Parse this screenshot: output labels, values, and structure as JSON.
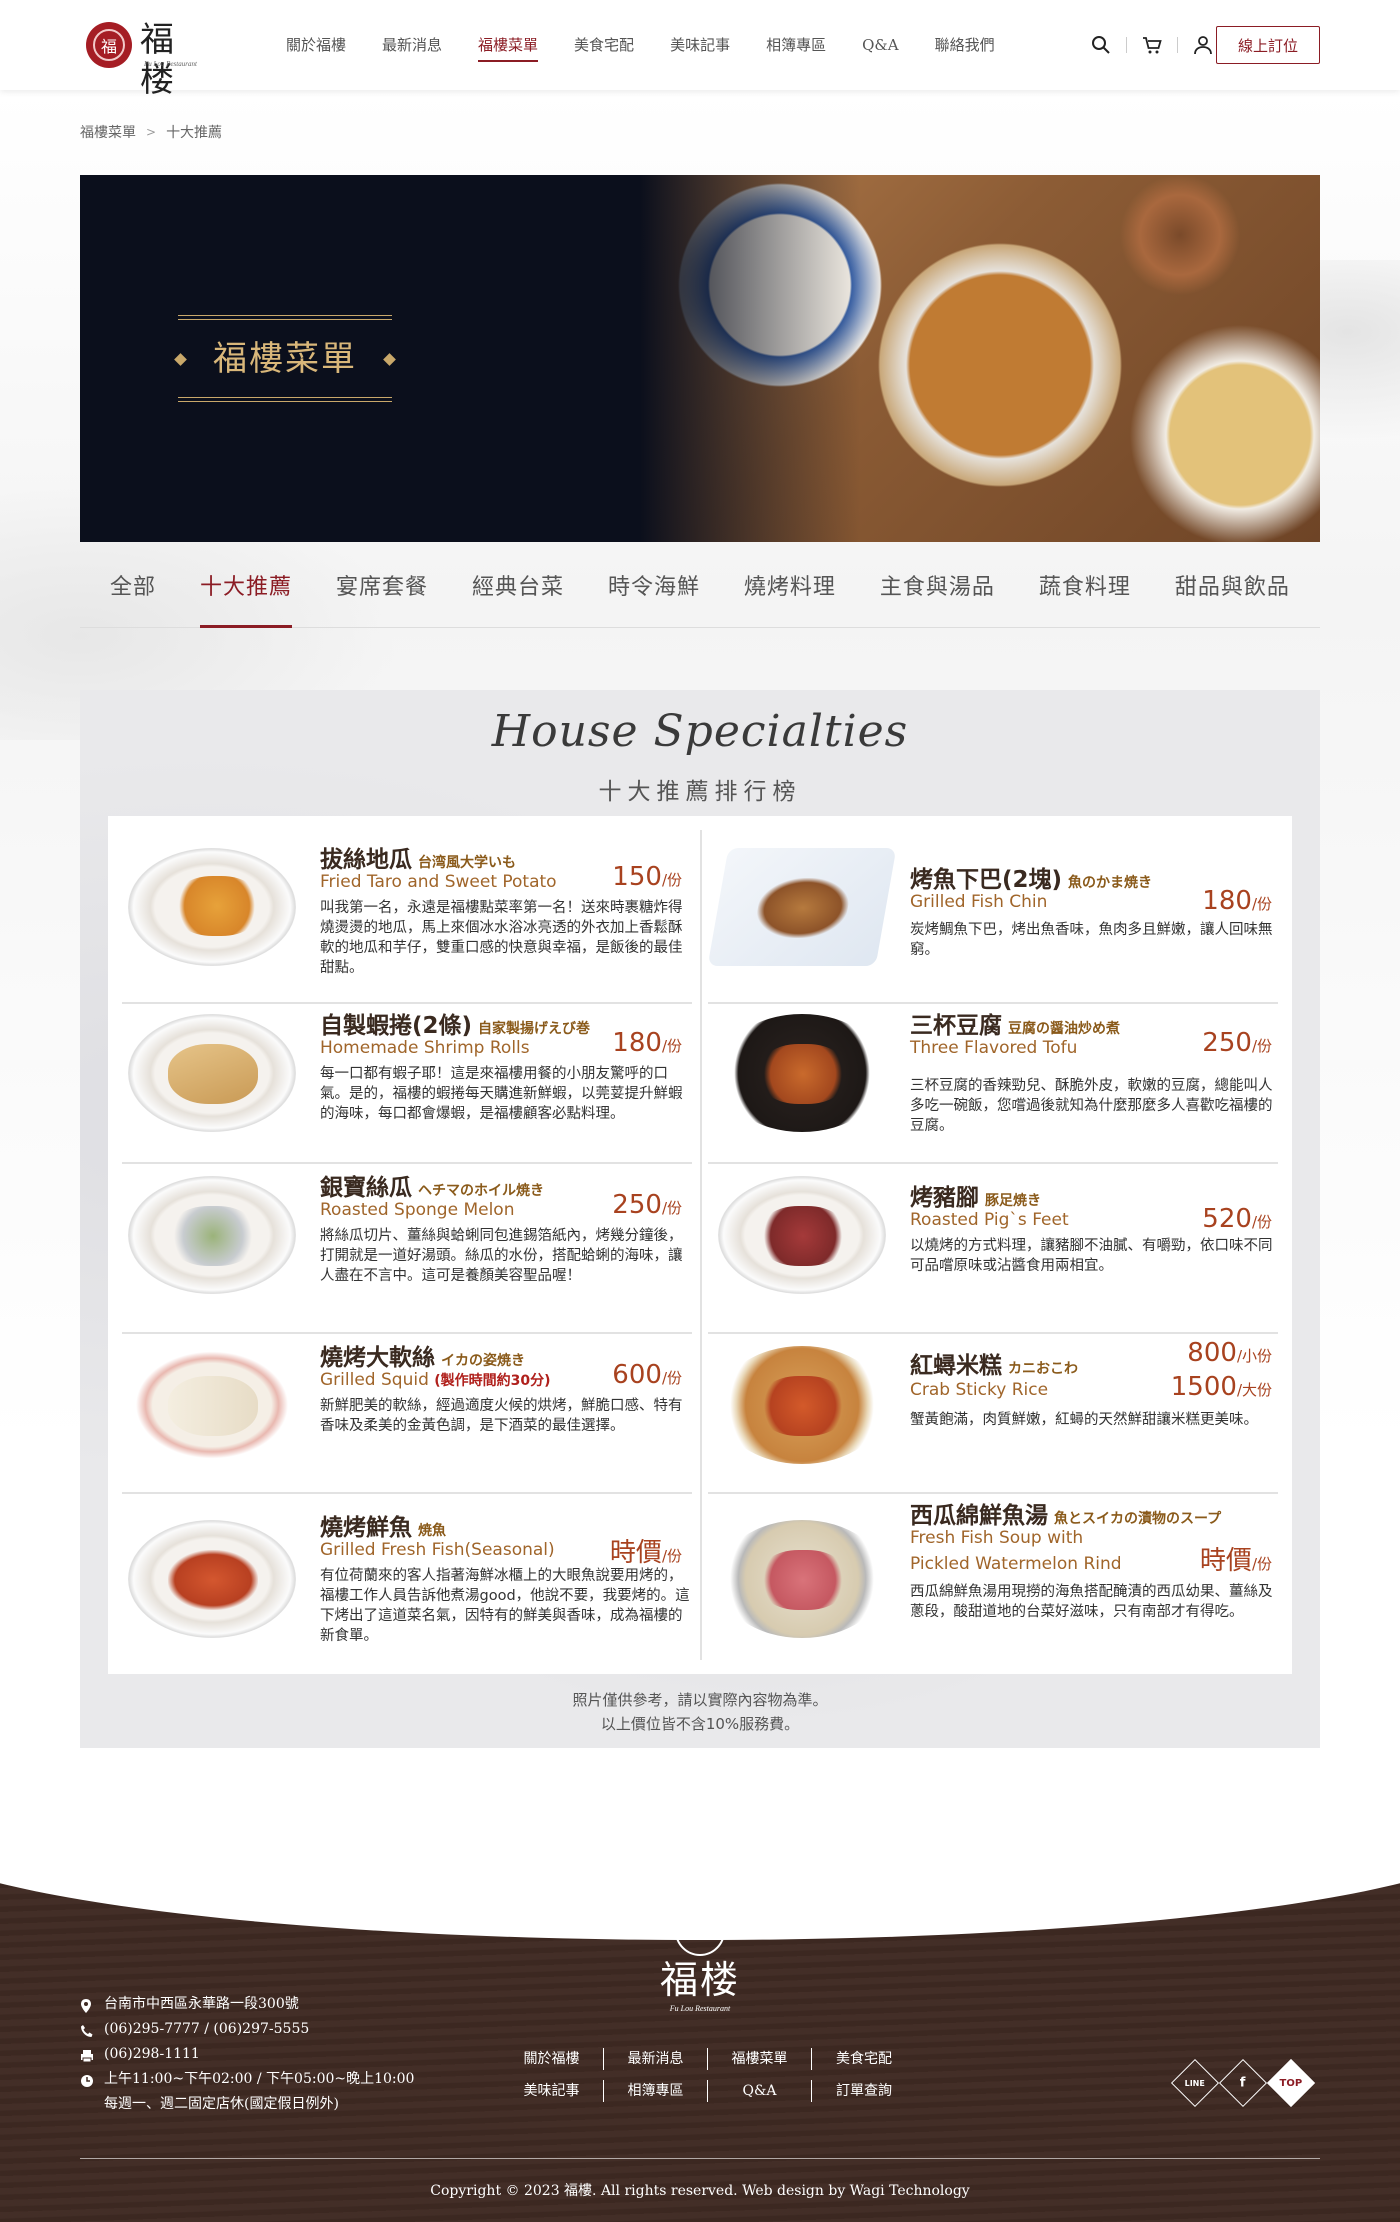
{
  "header": {
    "logo_text": "福楼",
    "logo_sub": "Fu Lou Restaurant",
    "nav": [
      "關於福樓",
      "最新消息",
      "福樓菜單",
      "美食宅配",
      "美味記事",
      "相簿專區",
      "Q&A",
      "聯絡我們"
    ],
    "active_nav": "福樓菜單",
    "book_label": "線上訂位"
  },
  "breadcrumb": [
    "福樓菜單",
    "十大推薦"
  ],
  "banner": {
    "title": "福樓菜單"
  },
  "tabs": [
    "全部",
    "十大推薦",
    "宴席套餐",
    "經典台菜",
    "時令海鮮",
    "燒烤料理",
    "主食與湯品",
    "蔬食料理",
    "甜品與飲品"
  ],
  "active_tab": "十大推薦",
  "board": {
    "title": "House Specialties",
    "subtitle": "十大推薦排行榜",
    "dishes": [
      {
        "name": "拔絲地瓜",
        "jp": "台湾風大学いも",
        "en": "Fried Taro and Sweet Potato",
        "price": "150",
        "unit": "/份",
        "desc": "叫我第一名，永遠是福樓點菜率第一名！送來時裹糖炸得燒燙燙的地瓜，馬上來個冰水浴冰亮透的外衣加上香鬆酥軟的地瓜和芋仔，雙重口感的快意與幸福，是飯後的最佳甜點。"
      },
      {
        "name": "烤魚下巴(2塊)",
        "jp": "魚のかま焼き",
        "en": "Grilled Fish Chin",
        "price": "180",
        "unit": "/份",
        "desc": "炭烤鯛魚下巴，烤出魚香味，魚肉多且鮮嫩，讓人回味無窮。"
      },
      {
        "name": "自製蝦捲(2條)",
        "jp": "自家製揚げえび巻",
        "en": "Homemade Shrimp Rolls",
        "price": "180",
        "unit": "/份",
        "desc": "每一口都有蝦子耶！這是來福樓用餐的小朋友驚呼的口氣。是的，福樓的蝦捲每天購進新鮮蝦，以莞荽提升鮮蝦的海味，每口都會爆蝦，是福樓顧客必點料理。"
      },
      {
        "name": "三杯豆腐",
        "jp": "豆腐の醤油炒め煮",
        "en": "Three Flavored Tofu",
        "price": "250",
        "unit": "/份",
        "desc": "三杯豆腐的香辣勁兒、酥脆外皮，軟嫩的豆腐，總能叫人多吃一碗飯，您嚐過後就知為什麼那麼多人喜歡吃福樓的豆腐。"
      },
      {
        "name": "銀寶絲瓜",
        "jp": "ヘチマのホイル焼き",
        "en": "Roasted Sponge Melon",
        "price": "250",
        "unit": "/份",
        "desc": "將絲瓜切片、薑絲與蛤蜊同包進錫箔紙內，烤幾分鐘後，打開就是一道好湯頭。絲瓜的水份，搭配蛤蜊的海味，讓人盡在不言中。這可是養顏美容聖品喔！"
      },
      {
        "name": "烤豬腳",
        "jp": "豚足焼き",
        "en": "Roasted Pig`s Feet",
        "price": "520",
        "unit": "/份",
        "desc": "以燒烤的方式料理，讓豬腳不油膩、有嚼勁，依口味不同可品嚐原味或沾醬食用兩相宜。"
      },
      {
        "name": "燒烤大軟絲",
        "jp": "イカの姿焼き",
        "en": "Grilled Squid",
        "en_note": "(製作時間約30分)",
        "price": "600",
        "unit": "/份",
        "desc": "新鮮肥美的軟絲，經過適度火候的烘烤，鮮脆口感、特有香味及柔美的金黃色調，是下酒菜的最佳選擇。"
      },
      {
        "name": "紅蟳米糕",
        "jp": "カニおこわ",
        "en": "Crab Sticky Rice",
        "price": "800",
        "unit": "/小份",
        "price2": "1500",
        "unit2": "/大份",
        "desc": "蟹黃飽滿，肉質鮮嫩，紅蟳的天然鮮甜讓米糕更美味。"
      },
      {
        "name": "燒烤鮮魚",
        "jp": "焼魚",
        "en": "Grilled Fresh Fish(Seasonal)",
        "price": "時價",
        "unit": "/份",
        "desc": "有位荷蘭來的客人指著海鮮冰櫃上的大眼魚說要用烤的，福樓工作人員告訴他煮湯good，他說不要，我要烤的。這下烤出了這道菜名氣，因特有的鮮美與香味，成為福樓的新食單。"
      },
      {
        "name": "西瓜綿鮮魚湯",
        "jp": "魚とスイカの漬物のスープ",
        "en": "Fresh Fish Soup with",
        "en_line2": "Pickled Watermelon Rind",
        "price": "時價",
        "unit": "/份",
        "desc": "西瓜綿鮮魚湯用現撈的海魚搭配醃漬的西瓜幼果、薑絲及蔥段，酸甜道地的台菜好滋味，只有南部才有得吃。"
      }
    ],
    "note_1": "照片僅供參考，請以實際內容物為準。",
    "note_2": "以上價位皆不含10%服務費。"
  },
  "footer": {
    "logo_text": "福楼",
    "logo_sub": "Fu Lou Restaurant",
    "address": "台南市中西區永華路一段300號",
    "phone": "(06)295-7777 / (06)297-5555",
    "fax": "(06)298-1111",
    "hours": "上午11:00~下午02:00 / 下午05:00~晚上10:00",
    "closed": "每週一、週二固定店休(國定假日例外)",
    "links": [
      "關於福樓",
      "最新消息",
      "福樓菜單",
      "美食宅配",
      "美味記事",
      "相簿專區",
      "Q&A",
      "訂單查詢"
    ],
    "social": [
      "LINE",
      "f",
      "TOP"
    ],
    "copyright": "Copyright © 2023 福樓. All rights reserved. Web design by Wagi Technology"
  },
  "colors": {
    "accent": "#8b1c24",
    "gold": "#c9a86a",
    "price": "#a8421f",
    "footer_bg": "#3f2a23"
  }
}
